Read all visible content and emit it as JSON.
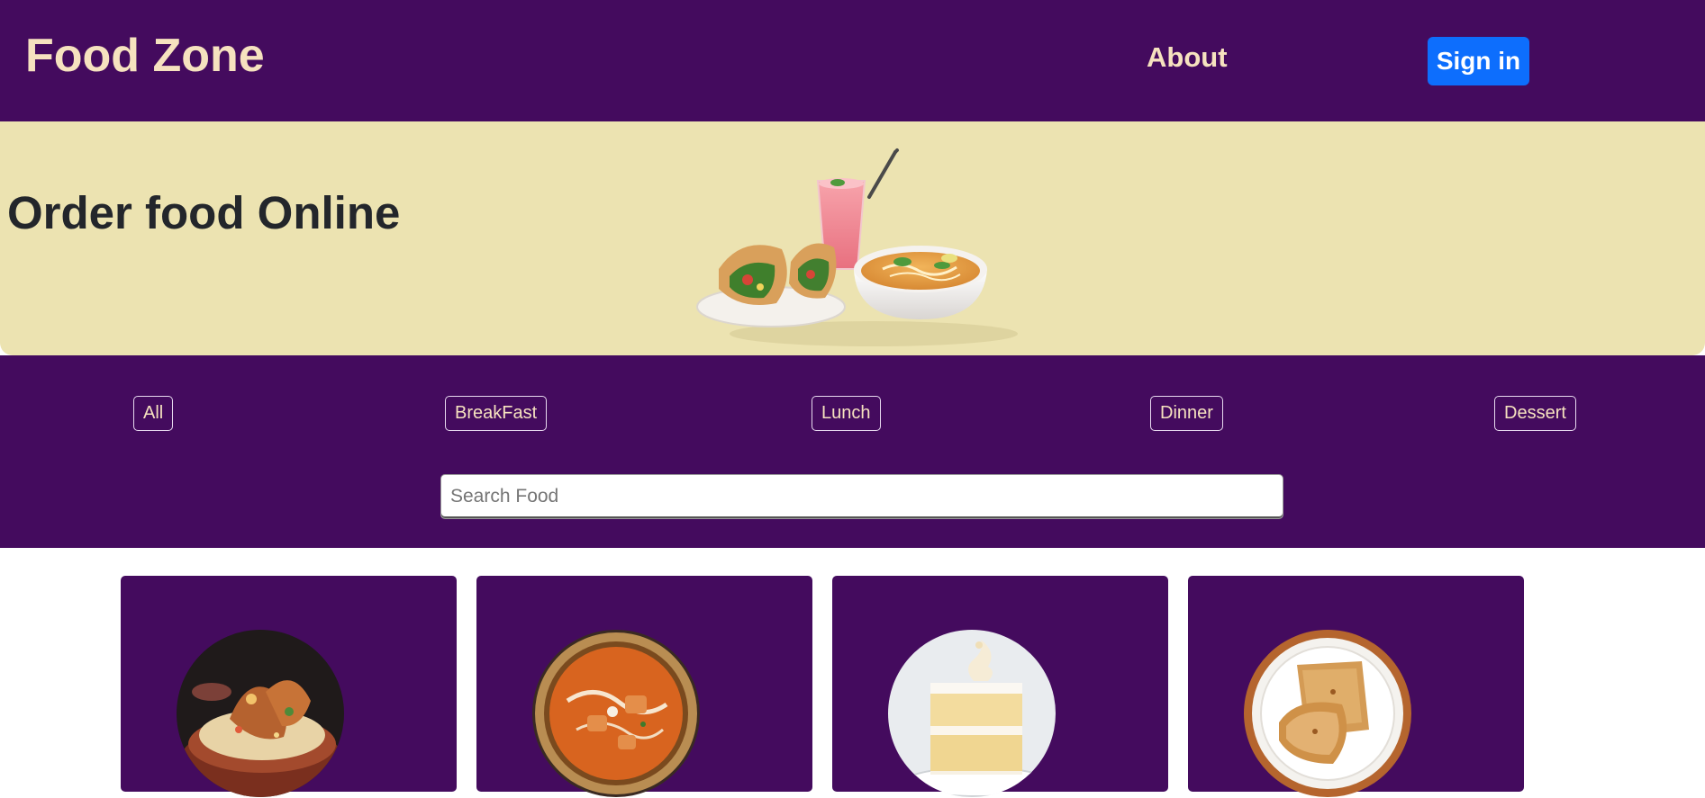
{
  "navbar": {
    "brand": "Food Zone",
    "about_label": "About",
    "signin_label": "Sign in"
  },
  "hero": {
    "title": "Order food Online"
  },
  "filters": {
    "buttons": [
      {
        "label": "All"
      },
      {
        "label": "BreakFast"
      },
      {
        "label": "Lunch"
      },
      {
        "label": "Dinner"
      },
      {
        "label": "Dessert"
      }
    ]
  },
  "search": {
    "placeholder": "Search Food",
    "value": ""
  },
  "cards": [
    {
      "image_icon": "biryani-image"
    },
    {
      "image_icon": "curry-image"
    },
    {
      "image_icon": "cake-image"
    },
    {
      "image_icon": "paratha-image"
    }
  ],
  "colors": {
    "brand_purple": "#440b5e",
    "hero_cream": "#ece3b1",
    "accent_text": "#f6e2bf",
    "primary_button": "#0d6efd"
  }
}
